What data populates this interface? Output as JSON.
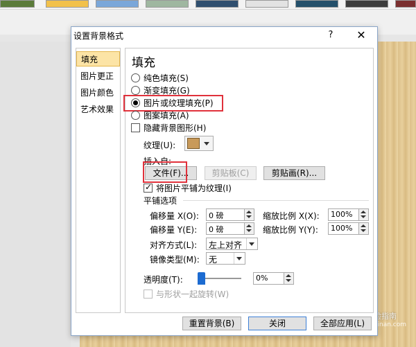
{
  "dialog": {
    "title": "设置背景格式",
    "help": "?",
    "close": "✕"
  },
  "nav": {
    "items": [
      {
        "label": "填充"
      },
      {
        "label": "图片更正"
      },
      {
        "label": "图片颜色"
      },
      {
        "label": "艺术效果"
      }
    ],
    "selected": "填充"
  },
  "fill": {
    "title": "填充",
    "options": [
      {
        "label": "纯色填充(S)"
      },
      {
        "label": "渐变填充(G)"
      },
      {
        "label": "图片或纹理填充(P)",
        "selected": true
      },
      {
        "label": "图案填充(A)"
      }
    ],
    "hide_bg": "隐藏背景图形(H)",
    "texture_label": "纹理(U):",
    "insert_from": "插入自:",
    "file_btn": "文件(F)...",
    "clipboard_btn": "剪贴板(C)",
    "clipart_btn": "剪贴画(R)...",
    "tile_checkbox": "将图片平铺为纹理(I)",
    "tile_options": "平铺选项",
    "offset_x_label": "偏移量 X(O):",
    "offset_x_value": "0 磅",
    "scale_x_label": "缩放比例 X(X):",
    "scale_x_value": "100%",
    "offset_y_label": "偏移量 Y(E):",
    "offset_y_value": "0 磅",
    "scale_y_label": "缩放比例 Y(Y):",
    "scale_y_value": "100%",
    "align_label": "对齐方式(L):",
    "align_value": "左上对齐",
    "mirror_label": "镜像类型(M):",
    "mirror_value": "无",
    "transparency_label": "透明度(T):",
    "transparency_value": "0%",
    "transparency_fraction": 0.0,
    "rotate_with_shape": "与形状一起旋转(W)"
  },
  "footer": {
    "reset": "重置背景(B)",
    "close": "关闭",
    "apply_all": "全部应用(L)"
  },
  "watermark": {
    "text": "经验指南",
    "url": "jingyanzhinan.com"
  },
  "colors": {
    "highlight": "#e0313b",
    "nav_selected": "#fce4a6",
    "slider": "#1c6bd1"
  }
}
